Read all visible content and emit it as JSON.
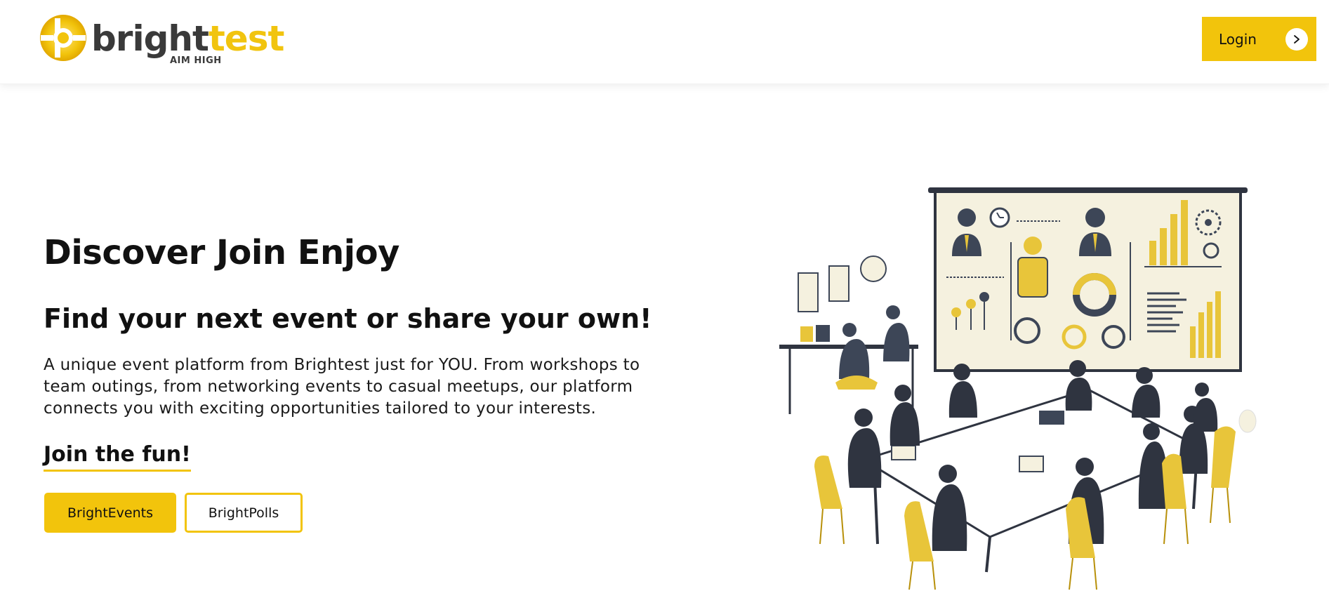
{
  "brand": {
    "word_dark": "bright",
    "word_light": "test",
    "tagline": "AIM HIGH",
    "colors": {
      "accent": "#f2c40c",
      "dark": "#3a3a3a"
    }
  },
  "header": {
    "login_label": "Login",
    "login_icon": "chevron-right-icon"
  },
  "hero": {
    "title": "Discover Join Enjoy",
    "subtitle": "Find your next event or share your own!",
    "description": "A unique event platform from Brightest just for YOU. From workshops to team outings, from networking events to casual meetups, our platform connects you with exciting opportunities tailored to your interests.",
    "cta_heading": "Join the fun!",
    "buttons": {
      "events_label": "BrightEvents",
      "polls_label": "BrightPolls"
    }
  }
}
